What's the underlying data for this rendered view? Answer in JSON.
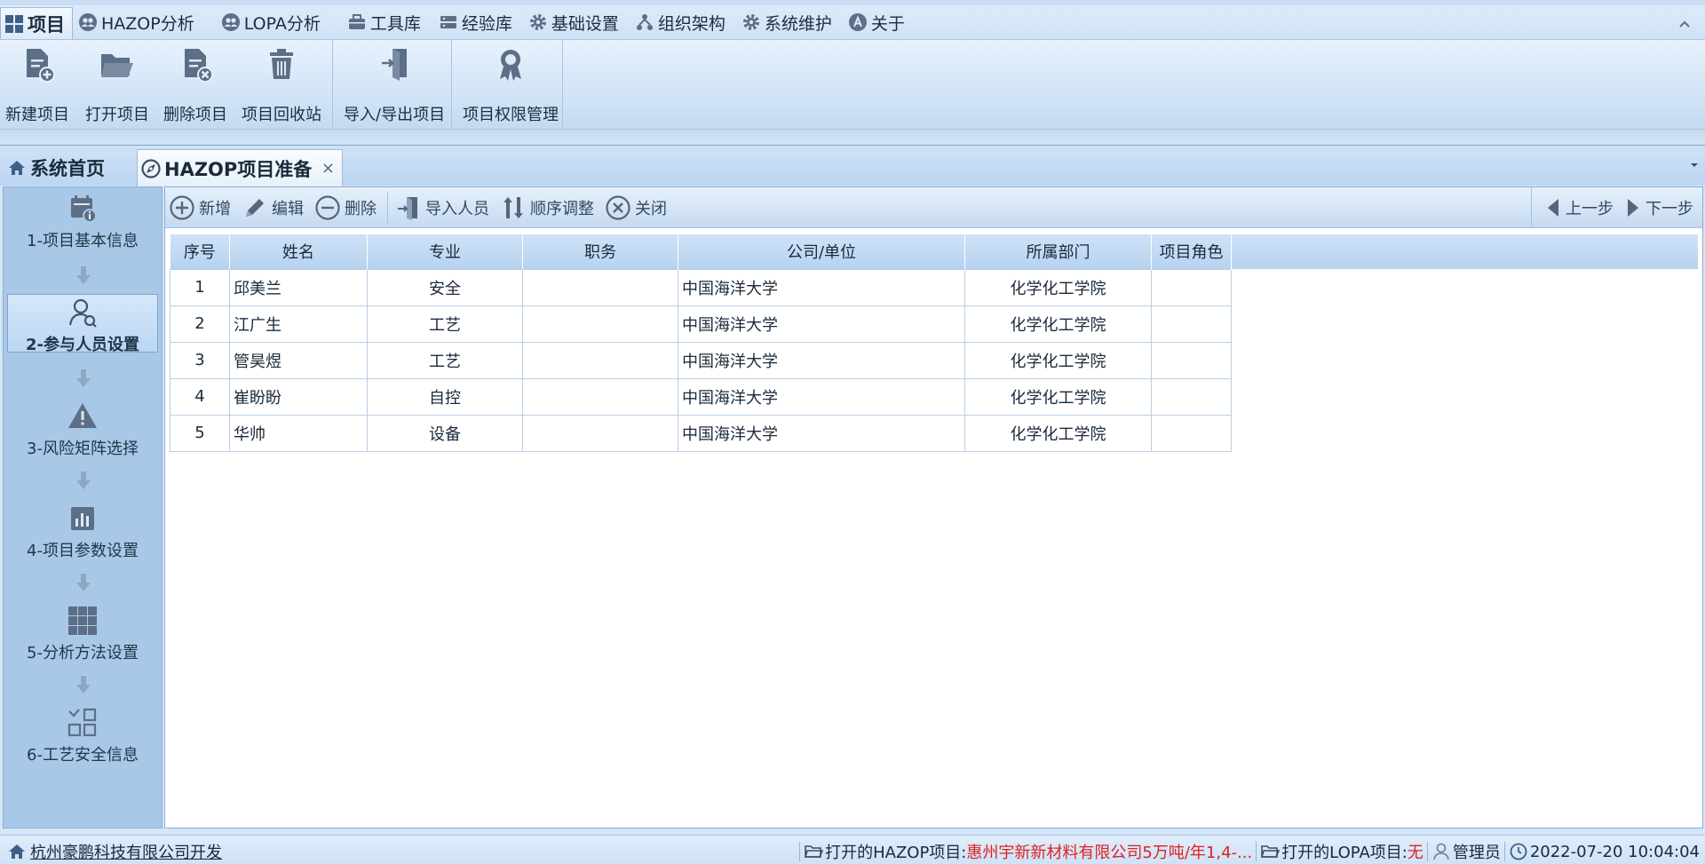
{
  "window": {
    "title": ""
  },
  "menubar": {
    "items": [
      {
        "label": "项目",
        "icon": "grid-icon"
      },
      {
        "label": "HAZOP分析",
        "icon": "people-icon"
      },
      {
        "label": "LOPA分析",
        "icon": "people-icon"
      },
      {
        "label": "工具库",
        "icon": "toolbox-icon"
      },
      {
        "label": "经验库",
        "icon": "server-icon"
      },
      {
        "label": "基础设置",
        "icon": "gear-icon"
      },
      {
        "label": "组织架构",
        "icon": "org-chart-icon"
      },
      {
        "label": "系统维护",
        "icon": "gear-icon"
      },
      {
        "label": "关于",
        "icon": "about-icon"
      }
    ]
  },
  "ribbon": {
    "buttons": [
      {
        "label": "新建项目",
        "icon": "new-document-icon"
      },
      {
        "label": "打开项目",
        "icon": "open-folder-icon"
      },
      {
        "label": "删除项目",
        "icon": "delete-document-icon"
      },
      {
        "label": "项目回收站",
        "icon": "trash-icon"
      },
      {
        "label": "导入/导出项目",
        "icon": "import-export-icon"
      },
      {
        "label": "项目权限管理",
        "icon": "award-icon"
      }
    ]
  },
  "tabs": {
    "home": "系统首页",
    "active": "HAZOP项目准备",
    "close": "×"
  },
  "steps": [
    {
      "label": "1-项目基本信息",
      "icon": "calendar-info-icon"
    },
    {
      "label": "2-参与人员设置",
      "icon": "user-search-icon"
    },
    {
      "label": "3-风险矩阵选择",
      "icon": "warning-icon"
    },
    {
      "label": "4-项目参数设置",
      "icon": "bar-chart-icon"
    },
    {
      "label": "5-分析方法设置",
      "icon": "grid-icon"
    },
    {
      "label": "6-工艺安全信息",
      "icon": "settings-grid-icon"
    }
  ],
  "toolbar": {
    "add": "新增",
    "edit": "编辑",
    "delete": "删除",
    "import": "导入人员",
    "reorder": "顺序调整",
    "close": "关闭",
    "prev": "上一步",
    "next": "下一步"
  },
  "table": {
    "columns": [
      "序号",
      "姓名",
      "专业",
      "职务",
      "公司/单位",
      "所属部门",
      "项目角色"
    ],
    "rows": [
      [
        "1",
        "邱美兰",
        "安全",
        "",
        "中国海洋大学",
        "化学化工学院",
        ""
      ],
      [
        "2",
        "江广生",
        "工艺",
        "",
        "中国海洋大学",
        "化学化工学院",
        ""
      ],
      [
        "3",
        "管昊煜",
        "工艺",
        "",
        "中国海洋大学",
        "化学化工学院",
        ""
      ],
      [
        "4",
        "崔盼盼",
        "自控",
        "",
        "中国海洋大学",
        "化学化工学院",
        ""
      ],
      [
        "5",
        "华帅",
        "设备",
        "",
        "中国海洋大学",
        "化学化工学院",
        ""
      ]
    ]
  },
  "statusbar": {
    "company": "杭州豪鹏科技有限公司开发",
    "hazop_label": "打开的HAZOP项目:",
    "hazop_value": "惠州宇新新材料有限公司5万吨/年1,4-...",
    "lopa_label": "打开的LOPA项目:",
    "lopa_value": "无",
    "user": "管理员",
    "datetime": "2022-07-20 10:04:04"
  },
  "colors": {
    "accent": "#cfe2f6",
    "panel": "#a9c8e8",
    "status_red": "#e02020"
  }
}
